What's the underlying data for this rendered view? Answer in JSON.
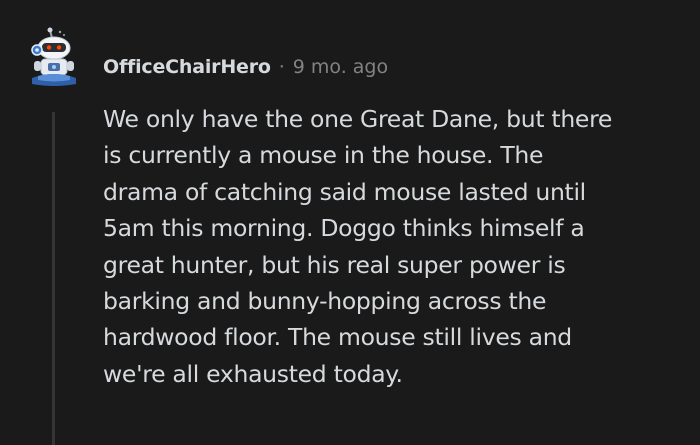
{
  "comment": {
    "author": "OfficeChairHero",
    "separator": "·",
    "age": "9 mo. ago",
    "avatar_icon": "robot-snoo-avatar-icon",
    "body_lines": [
      "We only have the one Great Dane, but there",
      "is currently a mouse in the house. The",
      "drama of catching said mouse lasted until",
      "5am this morning. Doggo thinks himself a",
      "great hunter, but his real super power is",
      "barking and bunny-hopping across the",
      "hardwood floor. The mouse still lives and",
      "we're all exhausted today."
    ]
  },
  "colors": {
    "background": "#1a1a1b",
    "text": "#d7dadc",
    "muted": "#818384",
    "thread_line": "#343536"
  }
}
